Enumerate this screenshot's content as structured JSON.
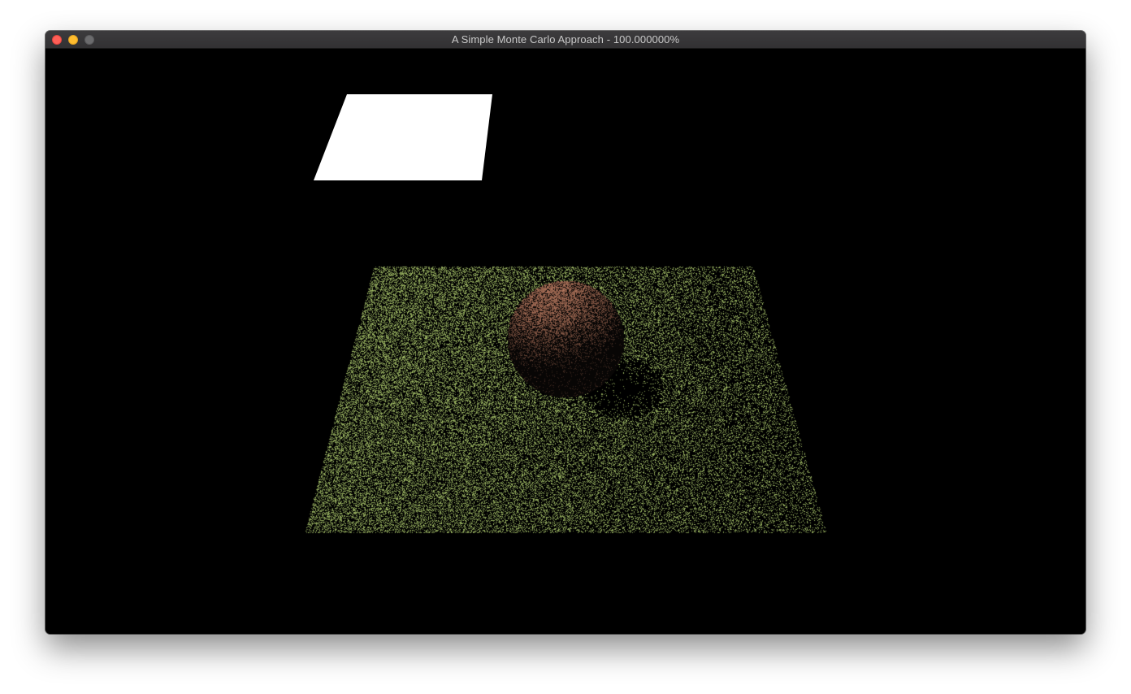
{
  "window": {
    "title": "A Simple Monte Carlo Approach - 100.000000%"
  },
  "render": {
    "progress": 1.0,
    "background_color": "#000000",
    "light_color": "#ffffff",
    "floor_color": "#a8c46a",
    "sphere_color": "#c48466"
  },
  "colors": {
    "close": "#ff5f57",
    "minimize": "#febc2e",
    "zoom": "#6b6b6d"
  }
}
